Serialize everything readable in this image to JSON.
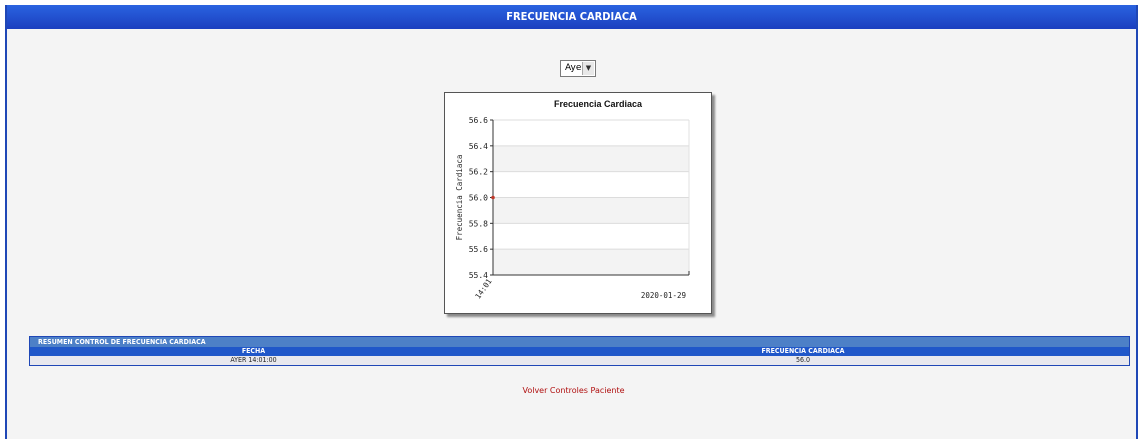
{
  "header": {
    "title": "FRECUENCIA CARDIACA"
  },
  "period": {
    "selected": "Ayer"
  },
  "chart_data": {
    "type": "line",
    "title": "Frecuencia Cardiaca",
    "xlabel": "",
    "ylabel": "Frecuencia Cardiaca",
    "ylim": [
      55.4,
      56.6
    ],
    "yticks": [
      "56.6",
      "56.4",
      "56.2",
      "56.0",
      "55.8",
      "55.6",
      "55.4"
    ],
    "x_tick_labels": [
      "14:01"
    ],
    "date_label": "2020-01-29",
    "grid": true,
    "series": [
      {
        "points": [
          {
            "x": "14:01",
            "y": 56.0
          }
        ],
        "color": "#c0392b"
      }
    ]
  },
  "summary": {
    "title": "RESUMEN CONTROL DE FRECUENCIA CARDIACA",
    "columns": [
      "FECHA",
      "FRECUENCIA CARDIACA"
    ],
    "rows": [
      [
        "AYER 14:01:00",
        "56.0"
      ]
    ]
  },
  "footer": {
    "back_link": "Volver Controles Paciente"
  }
}
